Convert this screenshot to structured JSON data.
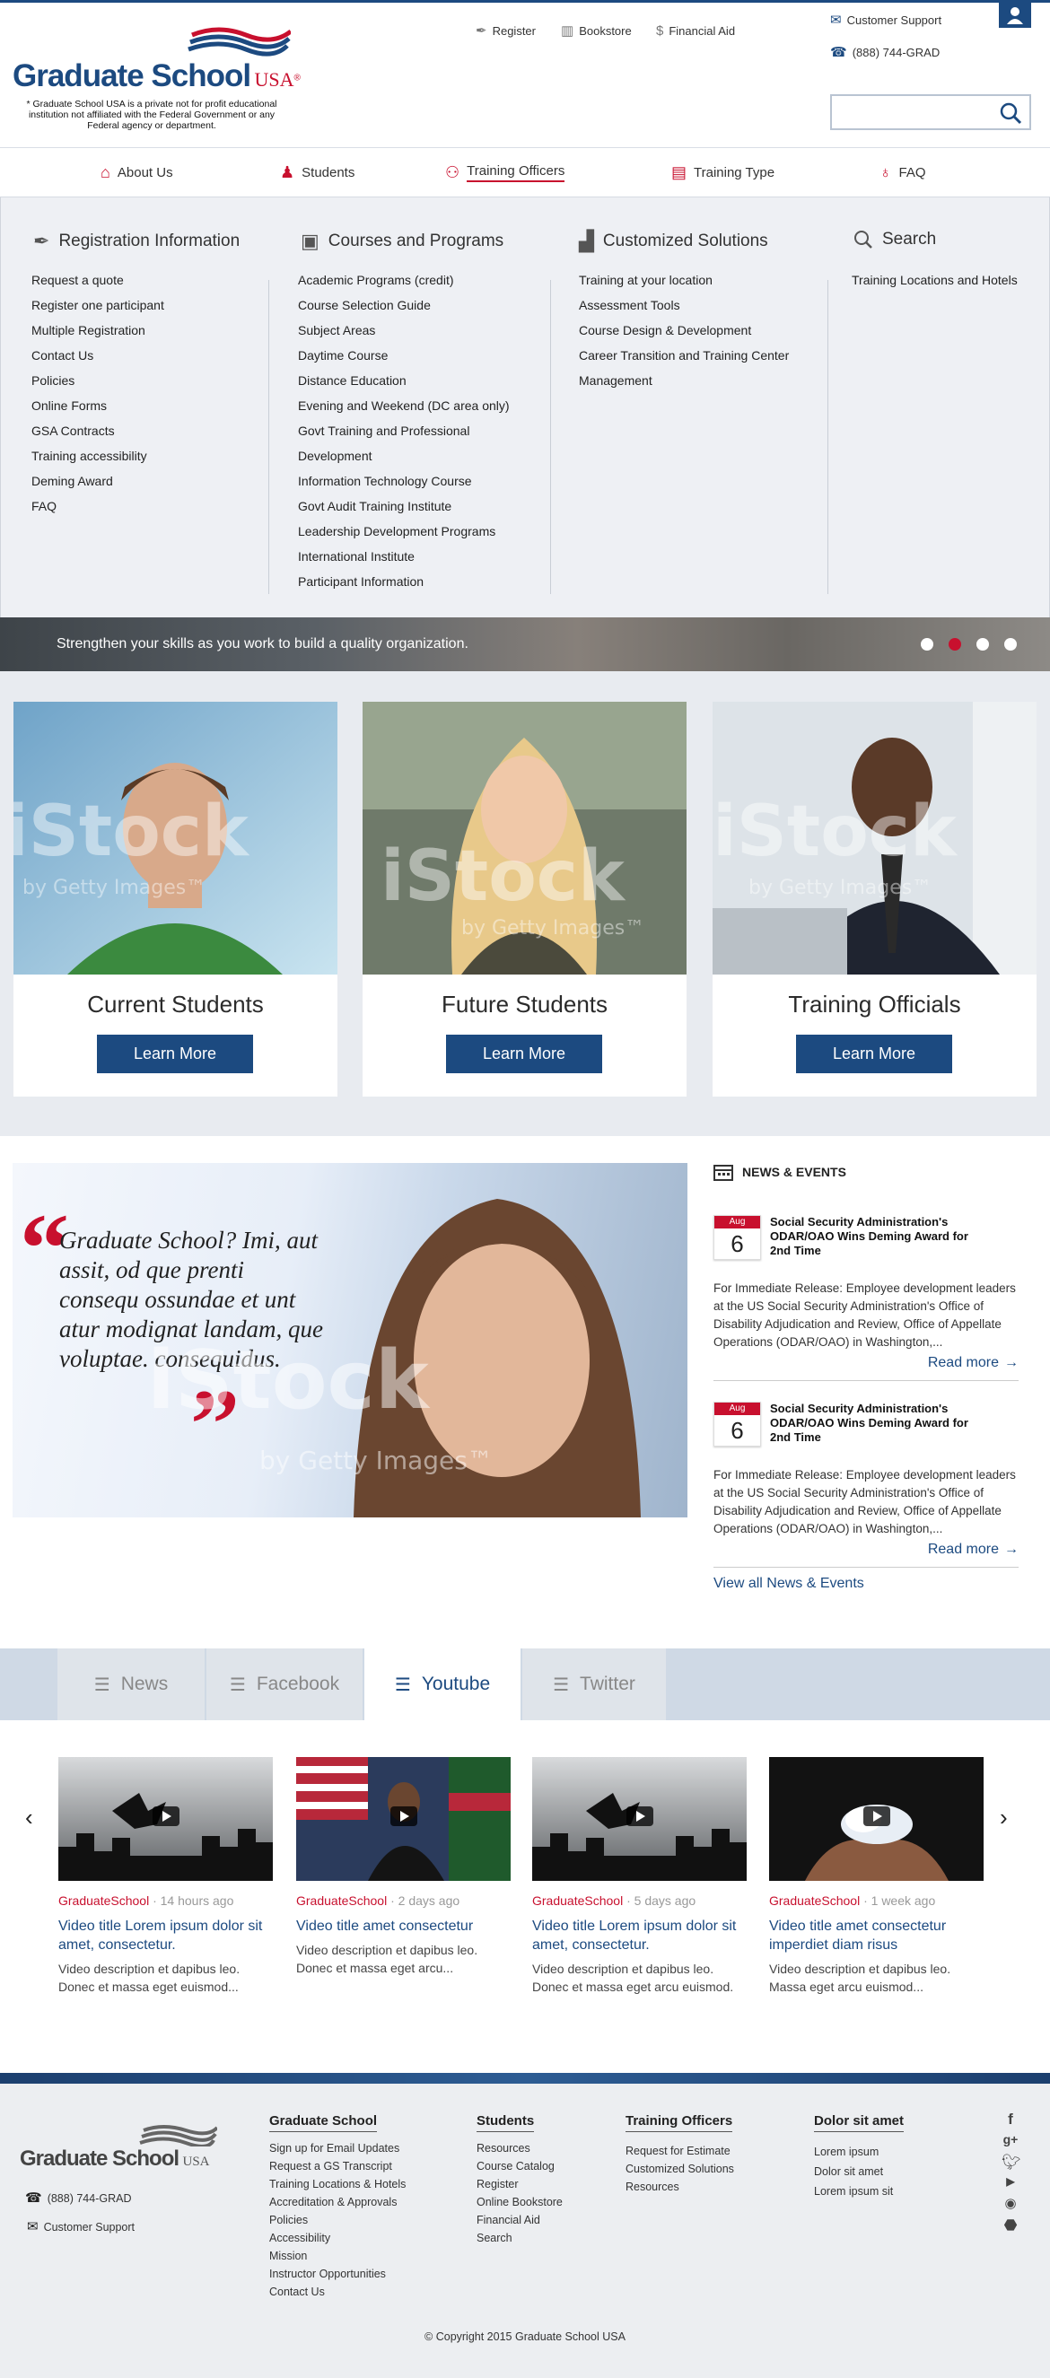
{
  "header": {
    "logo": {
      "word": "Graduate School",
      "usa": "USA",
      "reg": "®"
    },
    "logo_note": "* Graduate School USA is a private not for profit educational institution not affiliated with the Federal Government or any Federal agency or department.",
    "top_links": [
      {
        "label": "Register",
        "icon": "quill-icon"
      },
      {
        "label": "Bookstore",
        "icon": "books-icon"
      },
      {
        "label": "Financial Aid",
        "icon": "money-bag-icon"
      }
    ],
    "support": {
      "label": "Customer Support",
      "phone": "(888) 744-GRAD"
    },
    "search_placeholder": ""
  },
  "nav": {
    "items": [
      {
        "label": "About Us",
        "icon": "building-icon"
      },
      {
        "label": "Students",
        "icon": "student-icon"
      },
      {
        "label": "Training Officers",
        "icon": "meeting-icon",
        "active": true
      },
      {
        "label": "Training Type",
        "icon": "presentation-icon"
      },
      {
        "label": "FAQ",
        "icon": "lightbulb-icon"
      }
    ]
  },
  "mega": {
    "columns": [
      {
        "heading": "Registration Information",
        "items": [
          "Request a quote",
          "Register one participant",
          "Multiple Registration",
          "Contact Us",
          "Policies",
          "Online Forms",
          "GSA Contracts",
          "Training accessibility",
          "Deming Award",
          "FAQ"
        ]
      },
      {
        "heading": "Courses and Programs",
        "items": [
          "Academic Programs (credit)",
          "Course Selection Guide",
          "Subject Areas",
          "Daytime Course",
          "Distance Education",
          "Evening and Weekend (DC area only)",
          "Govt Training and Professional",
          "Development",
          "Information Technology Course",
          "Govt Audit Training Institute",
          "Leadership Development Programs",
          "International Institute",
          "Participant Information"
        ]
      },
      {
        "heading": "Customized Solutions",
        "items": [
          "Training at your location",
          "Assessment Tools",
          "Course Design & Development",
          "Career Transition and Training Center",
          "Management"
        ]
      },
      {
        "heading": "Search",
        "items": [
          "Training Locations and Hotels"
        ]
      }
    ]
  },
  "banner": {
    "text": "Strengthen your skills as you work to build a quality organization.",
    "slides": 4,
    "active_slide": 2
  },
  "cards": [
    {
      "title": "Current Students",
      "button": "Learn More"
    },
    {
      "title": "Future Students",
      "button": "Learn More"
    },
    {
      "title": "Training Officials",
      "button": "Learn More"
    }
  ],
  "watermark": {
    "brand": "iStock",
    "sub": "by Getty Images™"
  },
  "quote": {
    "text": "Graduate School? Imi, aut assit, od que prenti consequ ossundae et unt atur modignat landam, que voluptae. consequidus."
  },
  "news": {
    "heading": "NEWS & EVENTS",
    "items": [
      {
        "month": "Aug",
        "day": "6",
        "title": "Social Security Administration's ODAR/OAO Wins Deming Award for 2nd Time",
        "body": "For Immediate Release: Employee development leaders at the US Social Security Administration's Office of Disability Adjudication and Review, Office of Appellate Operations (ODAR/OAO) in Washington,...",
        "more": "Read more"
      },
      {
        "month": "Aug",
        "day": "6",
        "title": "Social Security Administration's ODAR/OAO Wins Deming Award for 2nd Time",
        "body": "For Immediate Release: Employee development leaders at the US Social Security Administration's Office of Disability Adjudication and Review, Office of Appellate Operations (ODAR/OAO) in Washington,...",
        "more": "Read more"
      }
    ],
    "view_all": "View all News & Events"
  },
  "tabs": [
    {
      "label": "News"
    },
    {
      "label": "Facebook"
    },
    {
      "label": "Youtube",
      "active": true
    },
    {
      "label": "Twitter"
    }
  ],
  "videos": [
    {
      "source": "GraduateSchool",
      "age": "14 hours ago",
      "title": "Video title Lorem ipsum dolor sit amet, consectetur.",
      "desc": "Video description et dapibus leo. Donec et massa eget euismod..."
    },
    {
      "source": "GraduateSchool",
      "age": "2 days ago",
      "title": "Video title amet consectetur",
      "desc": "Video description et dapibus leo. Donec et massa eget arcu..."
    },
    {
      "source": "GraduateSchool",
      "age": "5 days ago",
      "title": "Video title Lorem ipsum dolor sit amet, consectetur.",
      "desc": "Video description et dapibus leo. Donec et massa eget arcu euismod."
    },
    {
      "source": "GraduateSchool",
      "age": "1 week ago",
      "title": "Video title amet consectetur imperdiet diam risus",
      "desc": "Video description et dapibus leo. Massa eget arcu euismod..."
    }
  ],
  "footer": {
    "logo": {
      "word": "Graduate School",
      "usa": "USA"
    },
    "phone": "(888) 744-GRAD",
    "support": "Customer Support",
    "columns": [
      {
        "heading": "Graduate School",
        "items": [
          "Sign up for Email Updates",
          "Request a GS Transcript",
          "Training Locations & Hotels",
          "Accreditation & Approvals",
          "Policies",
          "Accessibility",
          "Mission",
          "Instructor Opportunities",
          "Contact Us"
        ]
      },
      {
        "heading": "Students",
        "items": [
          "Resources",
          "Course Catalog",
          "Register",
          "Online Bookstore",
          "Financial Aid",
          "Search"
        ]
      },
      {
        "heading": "Training Officers",
        "items": [
          "Request for Estimate",
          "Customized Solutions",
          "Resources"
        ]
      },
      {
        "heading": "Dolor sit amet",
        "items": [
          "Lorem ipsum",
          "Dolor sit amet",
          "Lorem ipsum sit"
        ]
      }
    ],
    "social": [
      "facebook-icon",
      "google-plus-icon",
      "twitter-icon",
      "youtube-icon",
      "rss-icon",
      "android-icon"
    ],
    "copyright": "© Copyright 2015 Graduate School USA"
  },
  "colors": {
    "brand_blue": "#1c4a80",
    "accent_red": "#c8102e",
    "panel_grey": "#eef0f4"
  }
}
